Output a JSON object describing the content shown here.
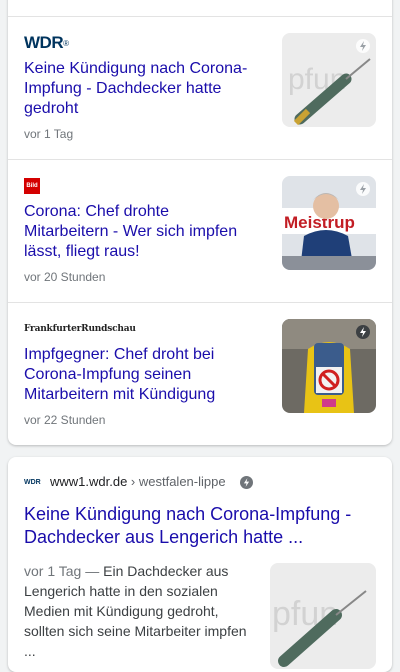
{
  "news": [
    {
      "source": "WDR",
      "source_mark": "®",
      "headline": "Keine Kündigung nach Corona-Impfung - Dachdecker hatte gedroht",
      "time": "vor 1 Tag",
      "thumb_icon": "syringe-image"
    },
    {
      "source": "Bild",
      "headline": "Corona: Chef drohte Mitarbeitern - Wer sich impfen lässt, fliegt raus!",
      "time": "vor 20 Stunden",
      "thumb_icon": "man-photo"
    },
    {
      "source": "FrankfurterRundschau",
      "headline": "Impfgegner: Chef droht bei Corona-Impfung seinen Mitarbeitern mit Kündigung",
      "time": "vor 22 Stunden",
      "thumb_icon": "protester-photo"
    }
  ],
  "result": {
    "favicon": "WDR",
    "url": "www1.wdr.de",
    "path": " › westfalen-lippe",
    "title": "Keine Kündigung nach Corona-Impfung - Dachdecker aus Lengerich hatte ...",
    "date": "vor 1 Tag —",
    "snippet": " Ein Dachdecker aus Lengerich hatte in den sozialen Medien mit Kündigung gedroht, sollten sich seine Mitarbeiter impfen ..."
  },
  "colors": {
    "link": "#1a0dab",
    "meta": "#70757a",
    "bild_red": "#d40000",
    "wdr_blue": "#00345e"
  }
}
